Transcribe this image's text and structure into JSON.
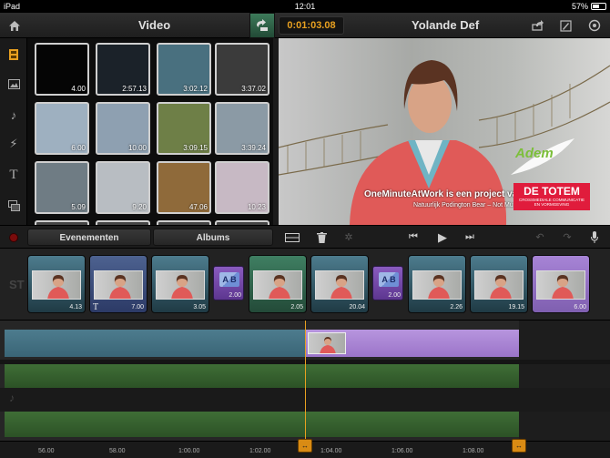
{
  "status_bar": {
    "device": "iPad",
    "time": "12:01",
    "battery_text": "57%",
    "battery_level": 0.57
  },
  "header": {
    "library_title": "Video",
    "timecode": "0:01:03.08",
    "project_title": "Yolande Def"
  },
  "library": {
    "thumbnails": [
      {
        "duration": "4.00",
        "bg": "#050505"
      },
      {
        "duration": "2:57.13",
        "bg": "#1b2229"
      },
      {
        "duration": "3:02.12",
        "bg": "#49707f"
      },
      {
        "duration": "3:37.02",
        "bg": "#3b3b3b"
      },
      {
        "duration": "6.00",
        "bg": "#9eb0c0"
      },
      {
        "duration": "10.00",
        "bg": "#8ea0b1"
      },
      {
        "duration": "3:09.15",
        "bg": "#6e7f47"
      },
      {
        "duration": "3:39.24",
        "bg": "#8b9aa5"
      },
      {
        "duration": "5.09",
        "bg": "#6f7c84"
      },
      {
        "duration": "9.20",
        "bg": "#b8bdc2"
      },
      {
        "duration": "47.06",
        "bg": "#8f6a3a"
      },
      {
        "duration": "10.23",
        "bg": "#c7b9c4"
      }
    ],
    "tabs": [
      "Evenementen",
      "Albums"
    ]
  },
  "preview": {
    "overlay_main": "OneMinuteAtWork is een project van",
    "overlay_sub": "Natuurlijk Podington Bear – Not Much",
    "logo_text": "Adem",
    "brand_name": "DE TOTEM",
    "brand_tagline_1": "CROSSMEDIALE COMMUNICATIE",
    "brand_tagline_2": "EN VORMGEVING",
    "brand_color": "#e01c3c"
  },
  "storyboard": {
    "label": "ST",
    "items": [
      {
        "kind": "clip",
        "duration": "4.13",
        "color": "#4d7c8e",
        "title": false
      },
      {
        "kind": "clip",
        "duration": "7.00",
        "color": "#4d6290",
        "title": true
      },
      {
        "kind": "clip",
        "duration": "3.05",
        "color": "#4d7c8e",
        "title": false
      },
      {
        "kind": "transition",
        "duration": "2.00"
      },
      {
        "kind": "clip",
        "duration": "2.05",
        "color": "#3f7f62",
        "title": false
      },
      {
        "kind": "clip",
        "duration": "20.04",
        "color": "#4d7c8e",
        "title": false
      },
      {
        "kind": "transition",
        "duration": "2.00"
      },
      {
        "kind": "clip",
        "duration": "2.26",
        "color": "#4d7c8e",
        "title": false
      },
      {
        "kind": "clip",
        "duration": "19.15",
        "color": "#4d7c8e",
        "title": false
      },
      {
        "kind": "clip",
        "duration": "6.00",
        "color": "#a784d6",
        "title": false
      }
    ]
  },
  "timeline": {
    "ticks": [
      "56.00",
      "58.00",
      "1:00.00",
      "1:02.00",
      "1:04.00",
      "1:06.00",
      "1:08.00"
    ]
  },
  "colors": {
    "accent": "#e8a020",
    "video_track": "#4d7c8e",
    "title_track": "#9b74c9",
    "audio_track": "#3f6e36"
  }
}
